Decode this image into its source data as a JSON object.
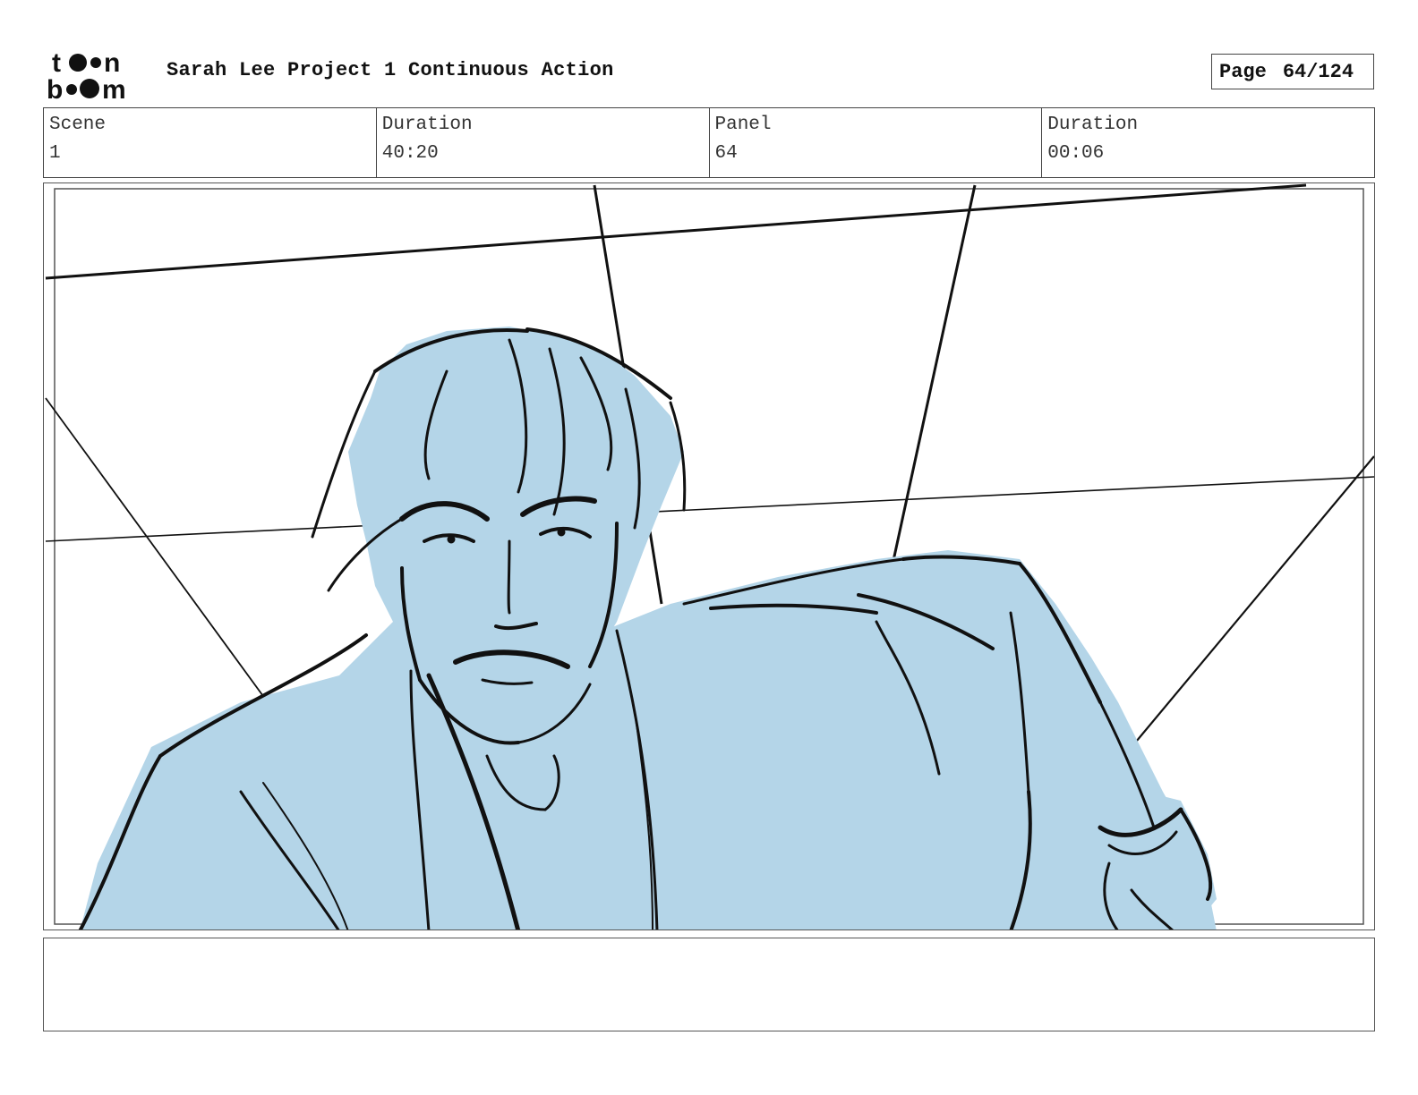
{
  "header": {
    "logo_alt": "toon boom",
    "project_title": "Sarah Lee Project 1 Continuous Action",
    "page_label": "Page",
    "page_value": "64/124"
  },
  "info": {
    "scene_label": "Scene",
    "scene_value": "1",
    "duration_label": "Duration",
    "duration_value": "40:20",
    "panel_label": "Panel",
    "panel_value": "64",
    "panel_duration_label": "Duration",
    "panel_duration_value": "00:06"
  },
  "panel": {
    "fill_color": "#b4d5e8",
    "line_color": "#111111"
  },
  "notes": {
    "text": ""
  }
}
